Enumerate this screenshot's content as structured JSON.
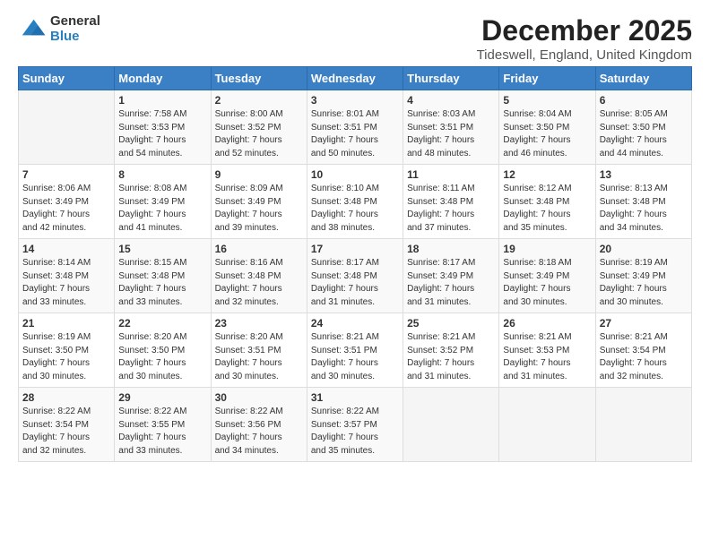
{
  "logo": {
    "general": "General",
    "blue": "Blue"
  },
  "title": "December 2025",
  "subtitle": "Tideswell, England, United Kingdom",
  "days_header": [
    "Sunday",
    "Monday",
    "Tuesday",
    "Wednesday",
    "Thursday",
    "Friday",
    "Saturday"
  ],
  "weeks": [
    [
      {
        "day": "",
        "info": ""
      },
      {
        "day": "1",
        "info": "Sunrise: 7:58 AM\nSunset: 3:53 PM\nDaylight: 7 hours\nand 54 minutes."
      },
      {
        "day": "2",
        "info": "Sunrise: 8:00 AM\nSunset: 3:52 PM\nDaylight: 7 hours\nand 52 minutes."
      },
      {
        "day": "3",
        "info": "Sunrise: 8:01 AM\nSunset: 3:51 PM\nDaylight: 7 hours\nand 50 minutes."
      },
      {
        "day": "4",
        "info": "Sunrise: 8:03 AM\nSunset: 3:51 PM\nDaylight: 7 hours\nand 48 minutes."
      },
      {
        "day": "5",
        "info": "Sunrise: 8:04 AM\nSunset: 3:50 PM\nDaylight: 7 hours\nand 46 minutes."
      },
      {
        "day": "6",
        "info": "Sunrise: 8:05 AM\nSunset: 3:50 PM\nDaylight: 7 hours\nand 44 minutes."
      }
    ],
    [
      {
        "day": "7",
        "info": "Sunrise: 8:06 AM\nSunset: 3:49 PM\nDaylight: 7 hours\nand 42 minutes."
      },
      {
        "day": "8",
        "info": "Sunrise: 8:08 AM\nSunset: 3:49 PM\nDaylight: 7 hours\nand 41 minutes."
      },
      {
        "day": "9",
        "info": "Sunrise: 8:09 AM\nSunset: 3:49 PM\nDaylight: 7 hours\nand 39 minutes."
      },
      {
        "day": "10",
        "info": "Sunrise: 8:10 AM\nSunset: 3:48 PM\nDaylight: 7 hours\nand 38 minutes."
      },
      {
        "day": "11",
        "info": "Sunrise: 8:11 AM\nSunset: 3:48 PM\nDaylight: 7 hours\nand 37 minutes."
      },
      {
        "day": "12",
        "info": "Sunrise: 8:12 AM\nSunset: 3:48 PM\nDaylight: 7 hours\nand 35 minutes."
      },
      {
        "day": "13",
        "info": "Sunrise: 8:13 AM\nSunset: 3:48 PM\nDaylight: 7 hours\nand 34 minutes."
      }
    ],
    [
      {
        "day": "14",
        "info": "Sunrise: 8:14 AM\nSunset: 3:48 PM\nDaylight: 7 hours\nand 33 minutes."
      },
      {
        "day": "15",
        "info": "Sunrise: 8:15 AM\nSunset: 3:48 PM\nDaylight: 7 hours\nand 33 minutes."
      },
      {
        "day": "16",
        "info": "Sunrise: 8:16 AM\nSunset: 3:48 PM\nDaylight: 7 hours\nand 32 minutes."
      },
      {
        "day": "17",
        "info": "Sunrise: 8:17 AM\nSunset: 3:48 PM\nDaylight: 7 hours\nand 31 minutes."
      },
      {
        "day": "18",
        "info": "Sunrise: 8:17 AM\nSunset: 3:49 PM\nDaylight: 7 hours\nand 31 minutes."
      },
      {
        "day": "19",
        "info": "Sunrise: 8:18 AM\nSunset: 3:49 PM\nDaylight: 7 hours\nand 30 minutes."
      },
      {
        "day": "20",
        "info": "Sunrise: 8:19 AM\nSunset: 3:49 PM\nDaylight: 7 hours\nand 30 minutes."
      }
    ],
    [
      {
        "day": "21",
        "info": "Sunrise: 8:19 AM\nSunset: 3:50 PM\nDaylight: 7 hours\nand 30 minutes."
      },
      {
        "day": "22",
        "info": "Sunrise: 8:20 AM\nSunset: 3:50 PM\nDaylight: 7 hours\nand 30 minutes."
      },
      {
        "day": "23",
        "info": "Sunrise: 8:20 AM\nSunset: 3:51 PM\nDaylight: 7 hours\nand 30 minutes."
      },
      {
        "day": "24",
        "info": "Sunrise: 8:21 AM\nSunset: 3:51 PM\nDaylight: 7 hours\nand 30 minutes."
      },
      {
        "day": "25",
        "info": "Sunrise: 8:21 AM\nSunset: 3:52 PM\nDaylight: 7 hours\nand 31 minutes."
      },
      {
        "day": "26",
        "info": "Sunrise: 8:21 AM\nSunset: 3:53 PM\nDaylight: 7 hours\nand 31 minutes."
      },
      {
        "day": "27",
        "info": "Sunrise: 8:21 AM\nSunset: 3:54 PM\nDaylight: 7 hours\nand 32 minutes."
      }
    ],
    [
      {
        "day": "28",
        "info": "Sunrise: 8:22 AM\nSunset: 3:54 PM\nDaylight: 7 hours\nand 32 minutes."
      },
      {
        "day": "29",
        "info": "Sunrise: 8:22 AM\nSunset: 3:55 PM\nDaylight: 7 hours\nand 33 minutes."
      },
      {
        "day": "30",
        "info": "Sunrise: 8:22 AM\nSunset: 3:56 PM\nDaylight: 7 hours\nand 34 minutes."
      },
      {
        "day": "31",
        "info": "Sunrise: 8:22 AM\nSunset: 3:57 PM\nDaylight: 7 hours\nand 35 minutes."
      },
      {
        "day": "",
        "info": ""
      },
      {
        "day": "",
        "info": ""
      },
      {
        "day": "",
        "info": ""
      }
    ]
  ]
}
